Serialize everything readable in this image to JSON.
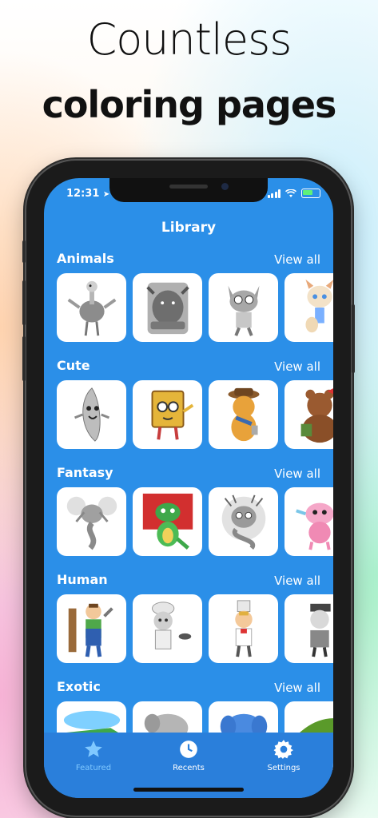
{
  "headline": {
    "line1": "Countless",
    "line2": "coloring pages"
  },
  "status_bar": {
    "time": "12:31"
  },
  "screen_title": "Library",
  "view_all_label": "View all",
  "sections": [
    {
      "name": "Animals",
      "thumbs": [
        "ostrich",
        "bull",
        "cat",
        "cat-girl"
      ]
    },
    {
      "name": "Cute",
      "thumbs": [
        "banana",
        "book",
        "bear-hat",
        "bear-brown"
      ]
    },
    {
      "name": "Fantasy",
      "thumbs": [
        "dragon-grey",
        "dragon-green",
        "monster",
        "pink-creature"
      ]
    },
    {
      "name": "Human",
      "thumbs": [
        "farmer",
        "chef-girl",
        "boy-chef",
        "man"
      ]
    },
    {
      "name": "Exotic",
      "thumbs": [
        "crocodile",
        "elephant-grey",
        "elephant-blue",
        "iguana"
      ]
    }
  ],
  "tabs": [
    {
      "label": "Featured",
      "icon": "star-icon"
    },
    {
      "label": "Recents",
      "icon": "clock-icon"
    },
    {
      "label": "Settings",
      "icon": "gear-icon"
    }
  ],
  "colors": {
    "screen_bg": "#2b8fe8",
    "tabbar_bg": "#2a7fdb",
    "active_tab": "#7fc8ff"
  }
}
